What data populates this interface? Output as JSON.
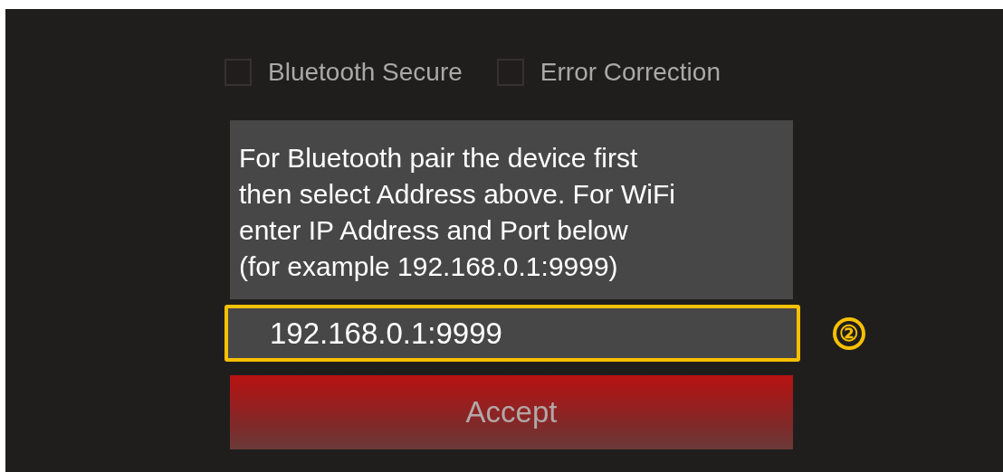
{
  "options": [
    {
      "label": "Bluetooth Secure",
      "checked": false
    },
    {
      "label": "Error Correction",
      "checked": false
    }
  ],
  "info_text": "For Bluetooth pair the device first\nthen select Address above. For WiFi\nenter IP Address and Port below\n(for example 192.168.0.1:9999)",
  "address_field": {
    "value": "192.168.0.1:9999",
    "highlighted": true
  },
  "callout": "②",
  "accept_button": {
    "label": "Accept"
  }
}
